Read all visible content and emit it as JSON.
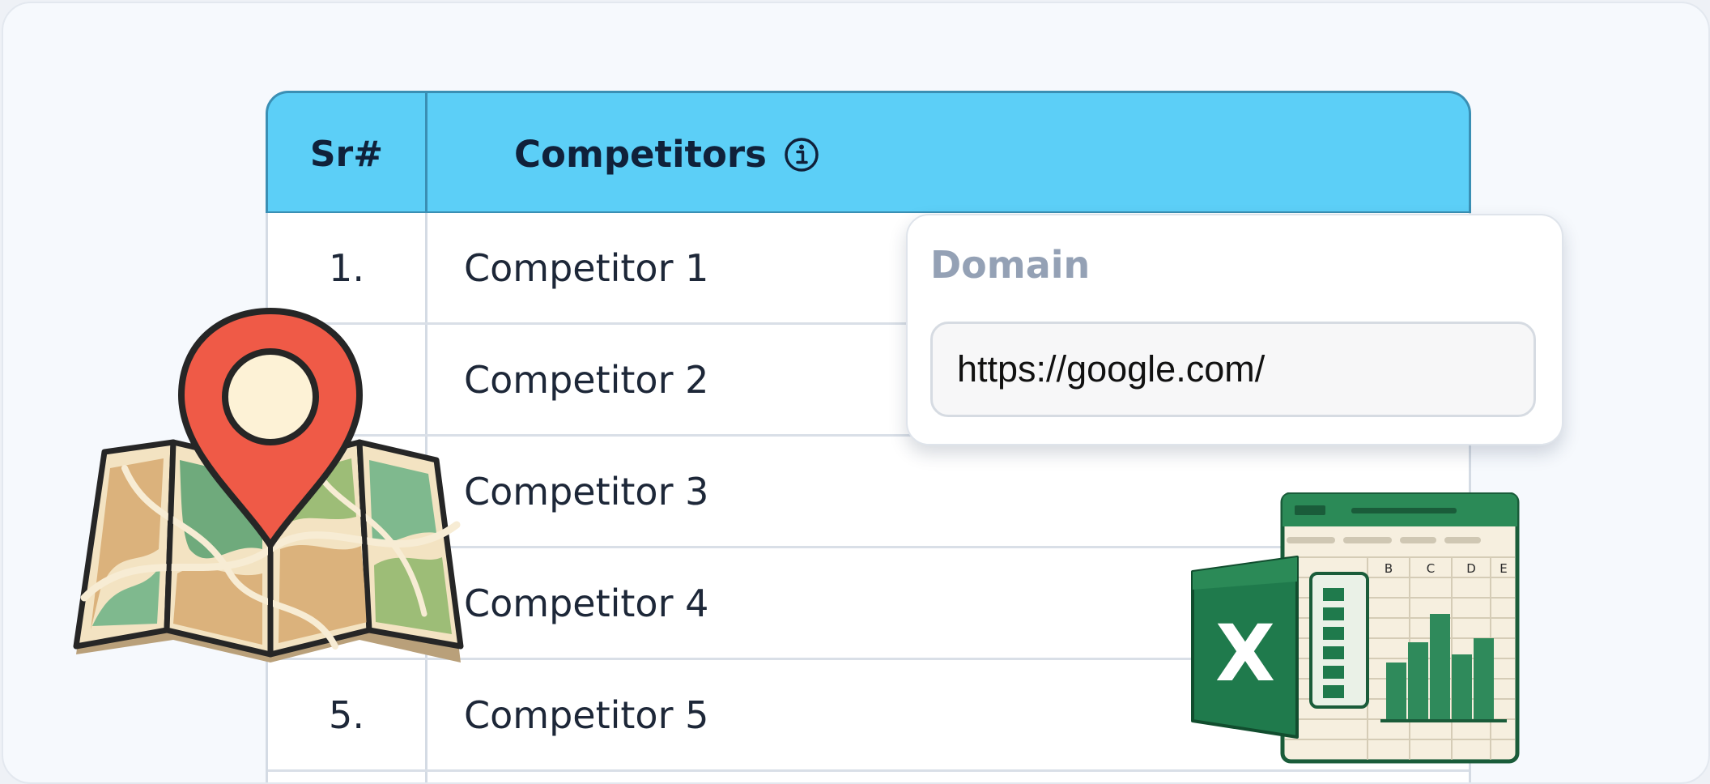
{
  "table": {
    "headers": {
      "sr": "Sr#",
      "competitors": "Competitors"
    },
    "rows": [
      {
        "num": "1.",
        "name": "Competitor 1"
      },
      {
        "num": "",
        "name": "Competitor 2"
      },
      {
        "num": "",
        "name": "Competitor 3"
      },
      {
        "num": "",
        "name": "Competitor 4"
      },
      {
        "num": "5.",
        "name": "Competitor 5"
      }
    ]
  },
  "domain_card": {
    "label": "Domain",
    "value": "https://google.com/"
  },
  "icons": {
    "info": "info-icon",
    "map": "map-pin-icon",
    "excel": "excel-icon"
  },
  "colors": {
    "header_bg": "#5ccff7",
    "header_border": "#3a8fb4",
    "pin_red": "#ef5a47",
    "excel_green": "#1f7a4c"
  }
}
